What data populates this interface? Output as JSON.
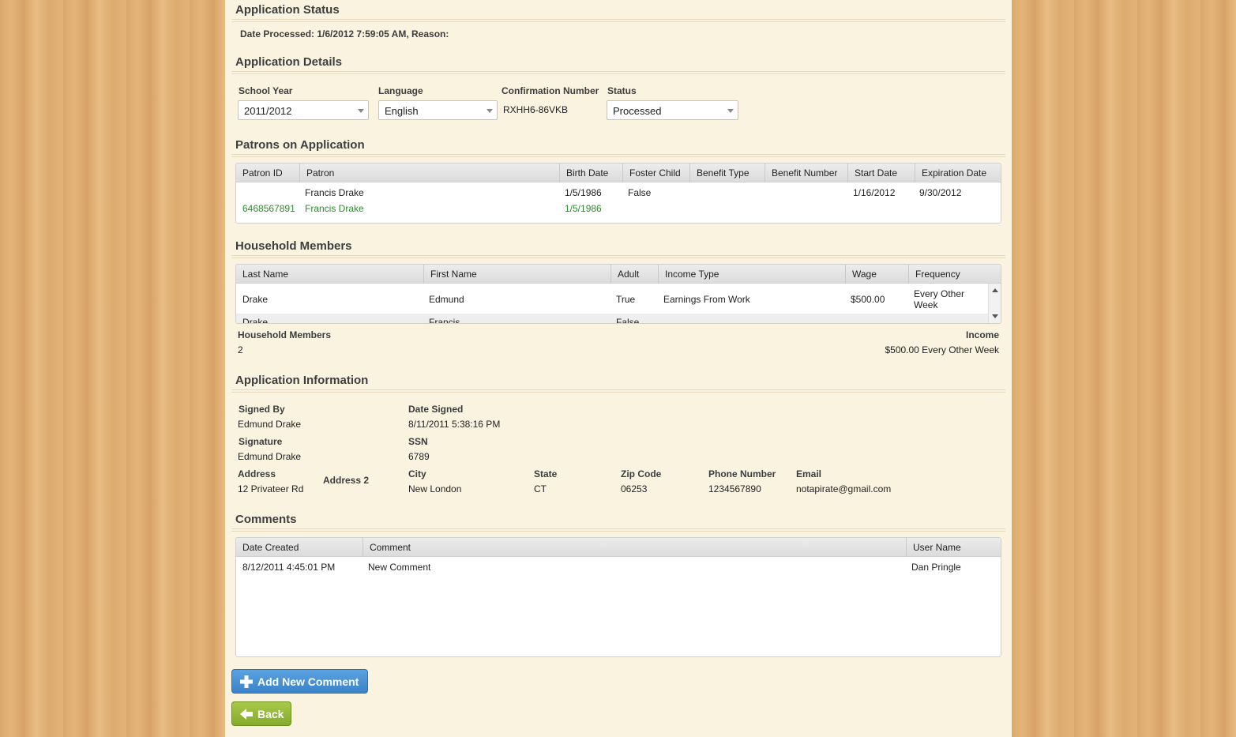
{
  "status": {
    "title": "Application Status",
    "line": "Date Processed: 1/6/2012 7:59:05 AM, Reason:"
  },
  "details": {
    "title": "Application Details",
    "school_year_label": "School Year",
    "school_year_value": "2011/2012",
    "language_label": "Language",
    "language_value": "English",
    "confirmation_label": "Confirmation Number",
    "confirmation_value": "RXHH6-86VKB",
    "status_label": "Status",
    "status_value": "Processed"
  },
  "patrons": {
    "title": "Patrons on Application",
    "columns": [
      "Patron ID",
      "Patron",
      "Birth Date",
      "Foster Child",
      "Benefit Type",
      "Benefit Number",
      "Start Date",
      "Expiration Date"
    ],
    "rows": [
      {
        "patron_id": "",
        "patron": "Francis Drake",
        "birth_date": "1/5/1986",
        "foster_child": "False",
        "benefit_type": "",
        "benefit_number": "",
        "start_date": "1/16/2012",
        "expiration_date": "9/30/2012"
      },
      {
        "patron_id": "6468567891",
        "patron": "Francis Drake",
        "birth_date": "1/5/1986",
        "foster_child": "",
        "benefit_type": "",
        "benefit_number": "",
        "start_date": "",
        "expiration_date": ""
      }
    ]
  },
  "household": {
    "title": "Household Members",
    "columns": [
      "Last Name",
      "First Name",
      "Adult",
      "Income Type",
      "Wage",
      "Frequency"
    ],
    "rows": [
      {
        "last_name": "Drake",
        "first_name": "Edmund",
        "adult": "True",
        "income_type": "Earnings From Work",
        "wage": "$500.00",
        "frequency": "Every Other Week"
      },
      {
        "last_name": "Drake",
        "first_name": "Francis",
        "adult": "False",
        "income_type": "",
        "wage": "",
        "frequency": ""
      }
    ],
    "members_label": "Household Members",
    "members_value": "2",
    "income_label": "Income",
    "income_value": "$500.00 Every Other Week"
  },
  "info": {
    "title": "Application Information",
    "signed_by_label": "Signed By",
    "signed_by_value": "Edmund Drake",
    "date_signed_label": "Date Signed",
    "date_signed_value": "8/11/2011 5:38:16 PM",
    "signature_label": "Signature",
    "signature_value": "Edmund Drake",
    "ssn_label": "SSN",
    "ssn_value": "6789",
    "address_label": "Address",
    "address_value": "12 Privateer Rd",
    "address2_label": "Address 2",
    "city_label": "City",
    "city_value": "New London",
    "state_label": "State",
    "state_value": "CT",
    "zip_label": "Zip Code",
    "zip_value": "06253",
    "phone_label": "Phone Number",
    "phone_value": "1234567890",
    "email_label": "Email",
    "email_value": "notapirate@gmail.com"
  },
  "comments": {
    "title": "Comments",
    "columns": [
      "Date Created",
      "Comment",
      "User Name"
    ],
    "rows": [
      {
        "date_created": "8/12/2011 4:45:01 PM",
        "comment": "New Comment",
        "user_name": "Dan Pringle"
      }
    ]
  },
  "buttons": {
    "add_comment": "Add New Comment",
    "back": "Back"
  },
  "colors": {
    "accent_blue": "#3b83c8",
    "accent_green": "#86aa2c",
    "link_green": "#2e8b2e",
    "panel_bg": "#faf3e0"
  }
}
